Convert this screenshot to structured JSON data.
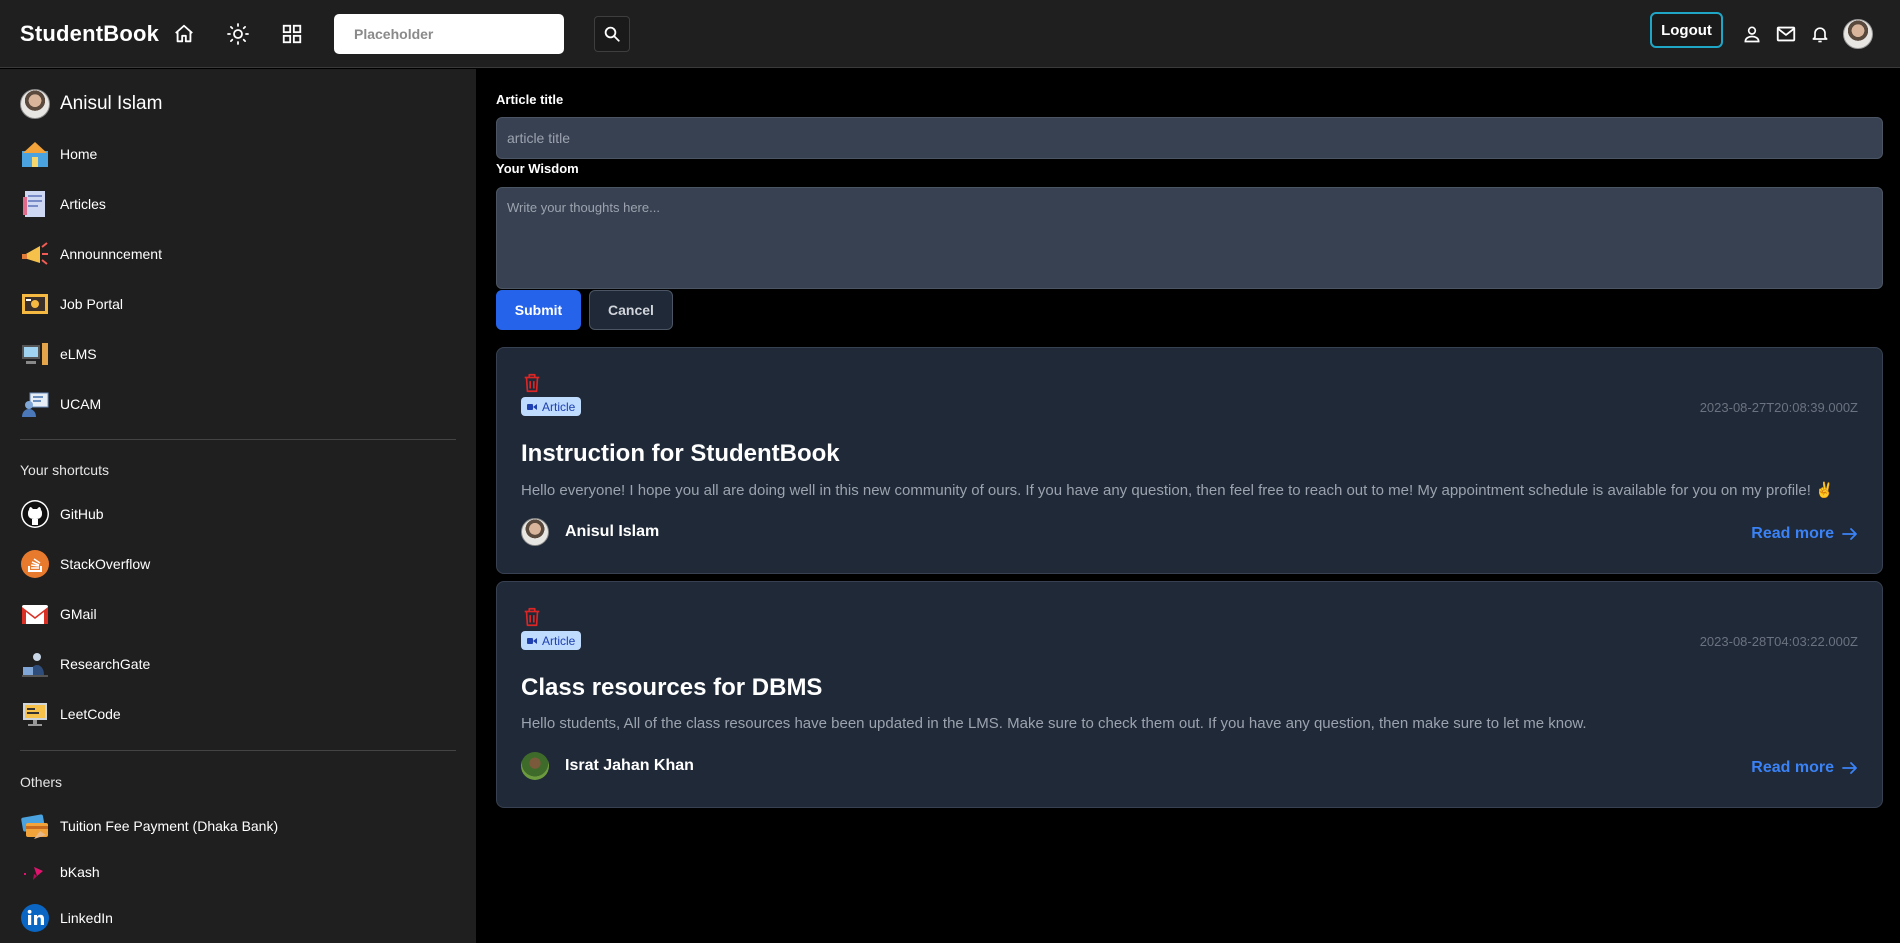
{
  "navbar": {
    "brand": "StudentBook",
    "search_placeholder": "Placeholder",
    "logout_label": "Logout"
  },
  "sidebar": {
    "user_name": "Anisul Islam",
    "main_items": [
      {
        "label": "Home",
        "icon": "home-icon"
      },
      {
        "label": "Articles",
        "icon": "articles-icon"
      },
      {
        "label": "Announncement",
        "icon": "megaphone-icon"
      },
      {
        "label": "Job Portal",
        "icon": "job-portal-icon"
      },
      {
        "label": "eLMS",
        "icon": "elms-icon"
      },
      {
        "label": "UCAM",
        "icon": "ucam-icon"
      }
    ],
    "shortcuts_heading": "Your shortcuts",
    "shortcuts": [
      {
        "label": "GitHub",
        "icon": "github-icon"
      },
      {
        "label": "StackOverflow",
        "icon": "stackoverflow-icon"
      },
      {
        "label": "GMail",
        "icon": "gmail-icon"
      },
      {
        "label": "ResearchGate",
        "icon": "researchgate-icon"
      },
      {
        "label": "LeetCode",
        "icon": "leetcode-icon"
      }
    ],
    "others_heading": "Others",
    "others": [
      {
        "label": "Tuition Fee Payment (Dhaka Bank)",
        "icon": "payment-icon"
      },
      {
        "label": "bKash",
        "icon": "bkash-icon"
      },
      {
        "label": "LinkedIn",
        "icon": "linkedin-icon"
      }
    ]
  },
  "form": {
    "title_label": "Article title",
    "title_placeholder": "article title",
    "wisdom_label": "Your Wisdom",
    "wisdom_placeholder": "Write your thoughts here...",
    "submit_label": "Submit",
    "cancel_label": "Cancel"
  },
  "posts": [
    {
      "badge": "Article",
      "date": "2023-08-27T20:08:39.000Z",
      "title": "Instruction for StudentBook",
      "body": "Hello everyone! I hope you all are doing well in this new community of ours. If you have any question, then feel free to reach out to me! My appointment schedule is available for you on my profile! ✌️",
      "author": "Anisul Islam",
      "read_more": "Read more"
    },
    {
      "badge": "Article",
      "date": "2023-08-28T04:03:22.000Z",
      "title": "Class resources for DBMS",
      "body": "Hello students, All of the class resources have been updated in the LMS. Make sure to check them out. If you have any question, then make sure to let me know.",
      "author": "Israt Jahan Khan",
      "read_more": "Read more"
    }
  ],
  "colors": {
    "primary": "#2563eb",
    "link": "#3b82f6",
    "delete": "#dc2626",
    "logout_border": "#1fa6c7"
  }
}
